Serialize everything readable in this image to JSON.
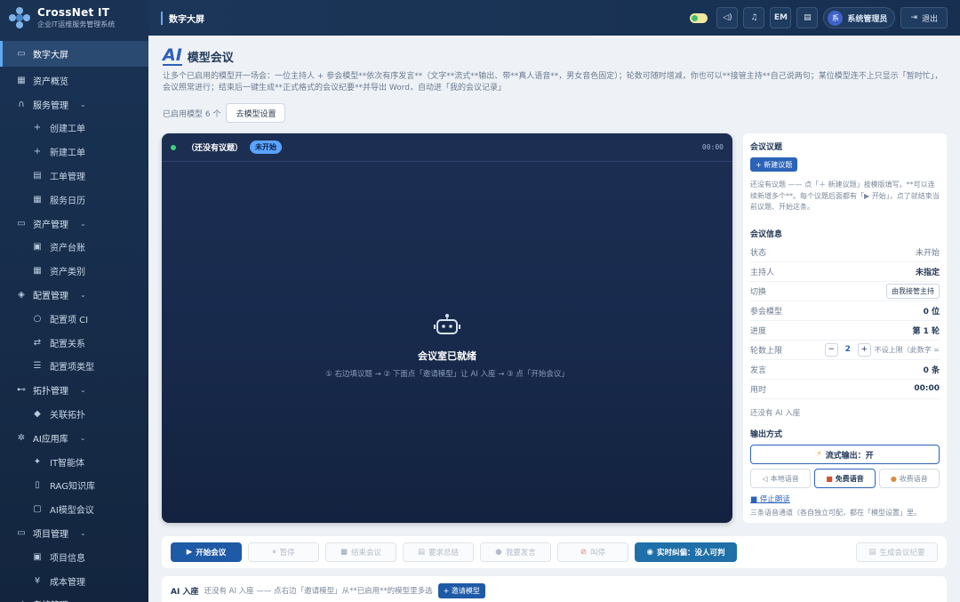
{
  "brand": {
    "name": "CrossNet IT",
    "subtitle": "企业IT运维服务管理系统"
  },
  "sidebar": {
    "items": [
      {
        "label": "数字大屏",
        "icon": "monitor-icon",
        "glyph": "▭",
        "type": "top",
        "active": true
      },
      {
        "label": "资产概览",
        "icon": "grid-icon",
        "glyph": "▦",
        "type": "top"
      },
      {
        "label": "服务管理",
        "icon": "headset-icon",
        "glyph": "∩",
        "type": "top",
        "chevron": true
      },
      {
        "label": "创建工单",
        "icon": "plus-icon",
        "glyph": "+",
        "type": "sub"
      },
      {
        "label": "新建工单",
        "icon": "plus-icon",
        "glyph": "+",
        "type": "sub"
      },
      {
        "label": "工单管理",
        "icon": "list-icon",
        "glyph": "▤",
        "type": "sub"
      },
      {
        "label": "服务日历",
        "icon": "calendar-icon",
        "glyph": "▦",
        "type": "sub"
      },
      {
        "label": "资产管理",
        "icon": "server-icon",
        "glyph": "▭",
        "type": "top",
        "chevron": true
      },
      {
        "label": "资产台账",
        "icon": "ledger-icon",
        "glyph": "▣",
        "type": "sub"
      },
      {
        "label": "资产类别",
        "icon": "category-icon",
        "glyph": "▦",
        "type": "sub"
      },
      {
        "label": "配置管理",
        "icon": "cube-icon",
        "glyph": "◈",
        "type": "top",
        "chevron": true
      },
      {
        "label": "配置项 CI",
        "icon": "circle-icon",
        "glyph": "○",
        "type": "sub"
      },
      {
        "label": "配置关系",
        "icon": "swap-icon",
        "glyph": "⇄",
        "type": "sub"
      },
      {
        "label": "配置项类型",
        "icon": "list-icon",
        "glyph": "☰",
        "type": "sub"
      },
      {
        "label": "拓扑管理",
        "icon": "topology-icon",
        "glyph": "⊷",
        "type": "top",
        "chevron": true
      },
      {
        "label": "关联拓扑",
        "icon": "diamond-icon",
        "glyph": "◆",
        "type": "sub"
      },
      {
        "label": "AI应用库",
        "icon": "gear-icon",
        "glyph": "✲",
        "type": "top",
        "chevron": true
      },
      {
        "label": "IT智能体",
        "icon": "sparkle-icon",
        "glyph": "✦",
        "type": "sub"
      },
      {
        "label": "RAG知识库",
        "icon": "book-icon",
        "glyph": "▯",
        "type": "sub"
      },
      {
        "label": "AI模型会议",
        "icon": "meeting-icon",
        "glyph": "▢",
        "type": "sub"
      },
      {
        "label": "项目管理",
        "icon": "folder-icon",
        "glyph": "▭",
        "type": "top",
        "chevron": true
      },
      {
        "label": "项目信息",
        "icon": "doc-icon",
        "glyph": "▣",
        "type": "sub"
      },
      {
        "label": "成本管理",
        "icon": "yen-icon",
        "glyph": "¥",
        "type": "sub"
      },
      {
        "label": "考核管理",
        "icon": "check-icon",
        "glyph": "✓",
        "type": "top",
        "chevron": true
      }
    ]
  },
  "topbar": {
    "title": "数字大屏",
    "user_initial": "系",
    "user_name": "系统管理员",
    "logout": "退出",
    "lang": "EM"
  },
  "page": {
    "title": "模型会议",
    "ai_logo": "AI",
    "desc": "让多个已启用的模型开一场会：一位主持人 + 参会模型**依次有序发言**（文字**流式**输出、带**真人语音**，男女音色固定）；轮数可随时增减，你也可以**接管主持**自己说两句；某位模型连不上只显示「暂时忙」，会议照常进行；结束后一键生成**正式格式的会议纪要**并导出 Word，自动进「我的会议记录」",
    "enabled_count": "已启用模型 6 个",
    "goto_settings": "去模型设置"
  },
  "stage": {
    "topic": "（还没有议题）",
    "status": "未开始",
    "timer": "00:00",
    "ready": "会议室已就绪",
    "hint": "① 右边填议题 → ② 下面点「邀请模型」让 AI 入座 → ③ 点「开始会议」"
  },
  "panel": {
    "topic_title": "会议议题",
    "new_topic": "+ 新建议题",
    "topic_desc": "还没有议题 —— 点「＋ 新建议题」按模版填写。**可以连续新增多个**。每个议题后面都有「▶ 开始」，点了就结束当前议题、开始这条。",
    "info_title": "会议信息",
    "rows": [
      {
        "label": "状态",
        "value": "未开始",
        "bold": false
      },
      {
        "label": "主持人",
        "value": "未指定",
        "bold": true
      },
      {
        "label": "切换",
        "value": "由我接管主持",
        "button": true
      },
      {
        "label": "参会模型",
        "value": "0 位",
        "bold": true
      },
      {
        "label": "进度",
        "value": "第 1 轮",
        "bold": true
      },
      {
        "label": "轮数上限",
        "value": "2",
        "stepper": true,
        "note": "不设上限（此数字 ="
      },
      {
        "label": "发言",
        "value": "0 条",
        "bold": true
      },
      {
        "label": "用时",
        "value": "00:00",
        "bold": true
      }
    ],
    "no_ai": "还没有 AI 入座",
    "output_title": "输出方式",
    "stream": "流式输出：开",
    "voice_local": "本地语音",
    "voice_free": "免费语音",
    "voice_paid": "收费语音",
    "stop_read": "停止朗读",
    "voice_note": "三条语音通道（各自独立可配，都在「模型设置」里。"
  },
  "controls": {
    "start": "开始会议",
    "pause": "暂停",
    "end": "结束会议",
    "summary": "要求总结",
    "speak": "我要发言",
    "stop": "叫停",
    "live": "实时纠偏：没人可判",
    "minutes": "生成会议纪要"
  },
  "aibar": {
    "label": "AI 入座",
    "text": "还没有 AI 入座 —— 点右边「邀请模型」从**已启用**的模型里多选",
    "invite": "+ 邀请模型"
  }
}
